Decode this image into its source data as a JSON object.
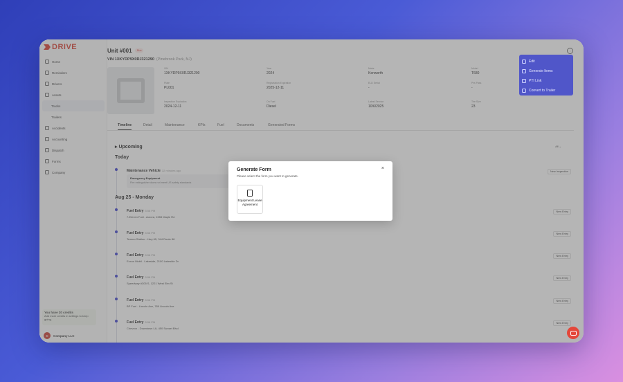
{
  "app": {
    "logo": "DRIVE",
    "company": "Company LLC",
    "company_initial": "C"
  },
  "sidebar": {
    "items": [
      {
        "label": "Home"
      },
      {
        "label": "Reminders"
      },
      {
        "label": "Drivers"
      },
      {
        "label": "Assets"
      },
      {
        "label": "Trucks"
      },
      {
        "label": "Trailers"
      },
      {
        "label": "Accidents"
      },
      {
        "label": "Accounting"
      },
      {
        "label": "Dispatch"
      },
      {
        "label": "Forms"
      },
      {
        "label": "Company"
      }
    ],
    "credits_title": "You have 20 credits",
    "credits_text": "Add more credits in settings to keep going."
  },
  "unit": {
    "title": "Unit #001",
    "badge": "Run",
    "vin": "VIN 1XKYDP9X0RJ321290",
    "location": "(Pinebrook Park, NJ)",
    "fields": {
      "vin_label": "VIN",
      "vin_value": "1XKYDP9X0RJ321290",
      "year_label": "Year",
      "year_value": "2024",
      "make_label": "Make",
      "make_value": "Kenworth",
      "model_label": "Model",
      "model_value": "T680",
      "plate_label": "Plate",
      "plate_value": "PL001",
      "reg_label": "Registration Expiration",
      "reg_value": "2025-12-11",
      "eld_label": "ELD Serial",
      "eld_value": "-",
      "prepass_label": "Pre-Pass",
      "prepass_value": "-",
      "insp_label": "Inspection Expiration",
      "insp_value": "2024-12-11",
      "fuel_label": "On Fuel",
      "fuel_value": "Diesel",
      "service_label": "Latest Service",
      "service_value": "10/6/2025",
      "tire_label": "Tire Size",
      "tire_value": "23"
    }
  },
  "tabs": [
    "Timeline",
    "Detail",
    "Maintenance",
    "KPIs",
    "Fuel",
    "Documents",
    "Generated Forms"
  ],
  "timeline": {
    "upcoming": "▸ Upcoming",
    "filter": "All",
    "today": "Today",
    "maintenance": {
      "title": "Maintenance Vehicle",
      "time": "32 minutes ago",
      "card_title": "Emergency Equipment",
      "card_desc": "Fire extinguisher does not meet US safety standards",
      "button": "New Inspection"
    },
    "day2": "Aug 25 - Monday",
    "entries": [
      {
        "title": "Fuel Entry",
        "time": "5:56 PM",
        "sub": "7-Eleven Fuel - Aurora, 1553 Maple Rd",
        "button": "New Entry"
      },
      {
        "title": "Fuel Entry",
        "time": "5:56 PM",
        "sub": "Texaco Station - Hwy 65, 344 Route 88",
        "button": "New Entry"
      },
      {
        "title": "Fuel Entry",
        "time": "5:56 PM",
        "sub": "Exxon Mobil - Lakeside, 2100 Lakeside Dr",
        "button": "New Entry"
      },
      {
        "title": "Fuel Entry",
        "time": "5:56 PM",
        "sub": "Speedway #305 S, 1221 West Elm St",
        "button": "New Entry"
      },
      {
        "title": "Fuel Entry",
        "time": "5:56 PM",
        "sub": "BP Fuel - Lincoln Ave, 789 Lincoln Ave",
        "button": "New Entry"
      },
      {
        "title": "Fuel Entry",
        "time": "5:56 PM",
        "sub": "Chevron - Downtown LA, 450 Sunset Blvd",
        "button": "New Entry"
      }
    ]
  },
  "dropdown": [
    "Edit",
    "Generate Items",
    "PTI Link",
    "Convert to Trailer"
  ],
  "modal": {
    "title": "Generate Form",
    "subtitle": "Please select the form you want to generate.",
    "close": "×",
    "card_label": "Equipment Lease Agreement"
  },
  "colors": {
    "accent": "#3b3fcf",
    "brand": "#d8392b",
    "dropdown_bg": "#5056c9"
  }
}
